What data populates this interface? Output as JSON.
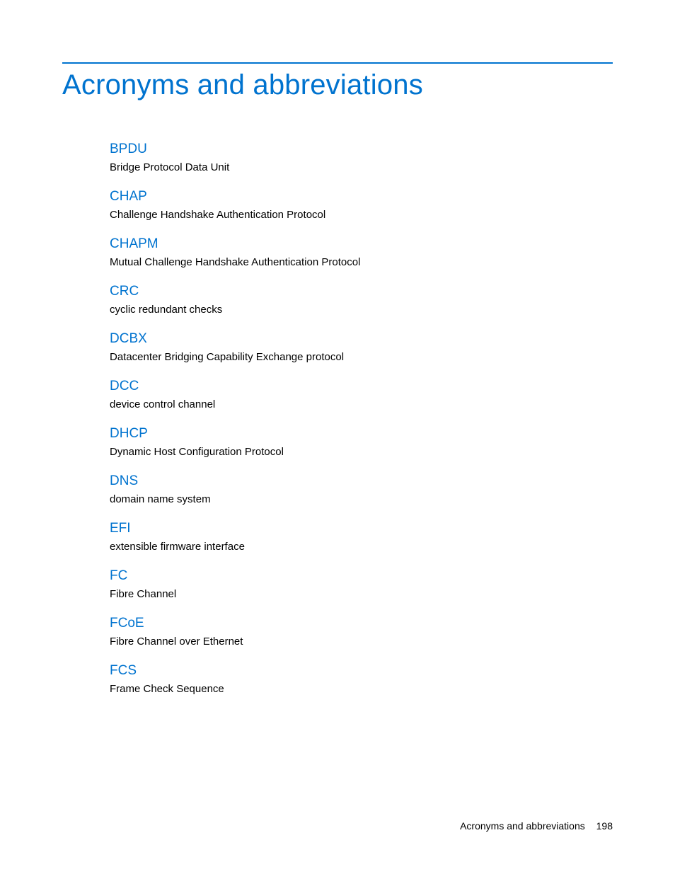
{
  "title": "Acronyms and abbreviations",
  "entries": [
    {
      "term": "BPDU",
      "definition": "Bridge Protocol Data Unit"
    },
    {
      "term": "CHAP",
      "definition": "Challenge Handshake Authentication Protocol"
    },
    {
      "term": "CHAPM",
      "definition": "Mutual Challenge Handshake Authentication Protocol"
    },
    {
      "term": "CRC",
      "definition": "cyclic redundant checks"
    },
    {
      "term": "DCBX",
      "definition": "Datacenter Bridging Capability Exchange protocol"
    },
    {
      "term": "DCC",
      "definition": "device control channel"
    },
    {
      "term": "DHCP",
      "definition": "Dynamic Host Configuration Protocol"
    },
    {
      "term": "DNS",
      "definition": "domain name system"
    },
    {
      "term": "EFI",
      "definition": "extensible firmware interface"
    },
    {
      "term": "FC",
      "definition": "Fibre Channel"
    },
    {
      "term": "FCoE",
      "definition": "Fibre Channel over Ethernet"
    },
    {
      "term": "FCS",
      "definition": "Frame Check Sequence"
    }
  ],
  "footer": {
    "section": "Acronyms and abbreviations",
    "page": "198"
  }
}
